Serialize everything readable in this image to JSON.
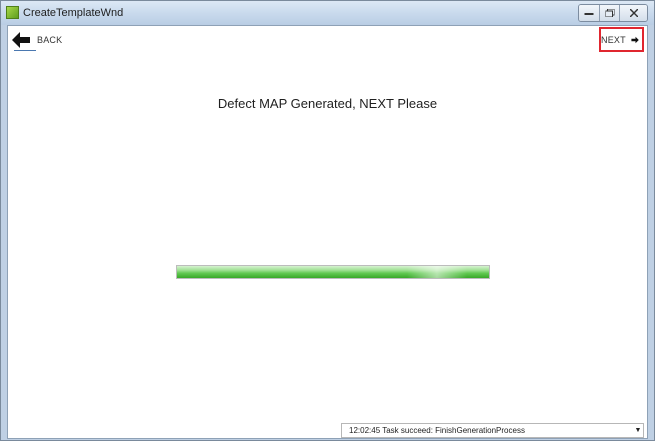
{
  "window": {
    "title": "CreateTemplateWnd"
  },
  "nav": {
    "back_label": "BACK",
    "next_label": "NEXT"
  },
  "main": {
    "message": "Defect MAP Generated, NEXT Please",
    "progress_fraction": 1.0
  },
  "status": {
    "log_entry": "12:02:45 Task succeed: FinishGenerationProcess"
  },
  "colors": {
    "highlight": "#e0262f",
    "progress_green": "#4fbf3f"
  },
  "icons": {
    "back": "arrow-left-icon",
    "next": "arrow-right-icon",
    "app": "app-icon"
  }
}
